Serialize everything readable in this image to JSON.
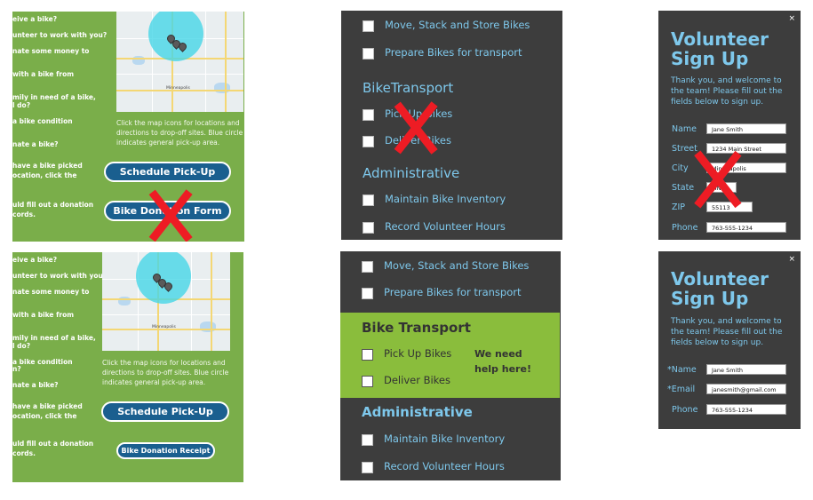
{
  "top_left": {
    "faq": [
      "eive a bike?",
      "unteer to work with you?",
      "nate some money to",
      "with a bike from",
      "mily in need of a bike,",
      "l do?",
      "a bike condition",
      "nate a bike?",
      "have a bike picked",
      "ocation, click the",
      "uld fill out a donation",
      "cords."
    ],
    "map_header": "Minneapolis",
    "map_city": "Minneapolis",
    "note": "Click the map icons for locations and directions to drop-off sites. Blue circle indicates general pick-up area.",
    "schedule_label": "Schedule Pick-Up",
    "donation_label": "Bike Donation Form"
  },
  "bottom_left": {
    "faq": [
      "eive a bike?",
      "unteer to work with you?",
      "nate some money to",
      "with a bike from",
      "mily in need of a bike,",
      "l do?",
      "a bike condition",
      "n?",
      "nate a bike?",
      "have a bike picked",
      "ocation, click the",
      "uld fill out a donation",
      "cords."
    ],
    "map_city": "Minneapolis",
    "note": "Click the map icons for locations and directions to drop-off sites. Blue circle indicates general pick-up area.",
    "schedule_label": "Schedule Pick-Up",
    "donation_label": "Bike Donation Receipt"
  },
  "top_middle": {
    "items_top": [
      "Move, Stack and Store Bikes",
      "Prepare Bikes for transport"
    ],
    "section1": "BikeTransport",
    "items_mid": [
      "Pick Up Bikes",
      "Deliver Bikes"
    ],
    "section2": "Administrative",
    "items_bottom": [
      "Maintain Bike Inventory",
      "Record Volunteer Hours"
    ]
  },
  "bottom_middle": {
    "items_top": [
      "Move, Stack and Store Bikes",
      "Prepare Bikes for transport"
    ],
    "section1": "Bike Transport",
    "items_mid": [
      "Pick Up Bikes",
      "Deliver Bikes"
    ],
    "need_help": [
      "We need",
      "help here!"
    ],
    "section2": "Administrative",
    "items_bottom": [
      "Maintain Bike Inventory",
      "Record Volunteer Hours"
    ]
  },
  "top_right": {
    "close": "×",
    "title": [
      "Volunteer",
      "Sign Up"
    ],
    "intro": "Thank you, and welcome to the team! Please fill out the fields below to sign up.",
    "fields": [
      {
        "label": "Name",
        "value": "Jane Smith"
      },
      {
        "label": "Street",
        "value": "1234 Main Street"
      },
      {
        "label": "City",
        "value": "Minneapolis"
      },
      {
        "label": "State",
        "value": "MN"
      },
      {
        "label": "ZIP",
        "value": "55113"
      },
      {
        "label": "Phone",
        "value": "763-555-1234"
      }
    ]
  },
  "bottom_right": {
    "close": "×",
    "title": [
      "Volunteer",
      "Sign Up"
    ],
    "intro": "Thank you, and welcome to the team! Please fill out the fields below to sign up.",
    "fields": [
      {
        "label": "*Name",
        "value": "Jane Smith"
      },
      {
        "label": "*Email",
        "value": "janesmith@gmail.com"
      },
      {
        "label": "Phone",
        "value": "763-555-1234"
      }
    ]
  },
  "colors": {
    "green": "#7aae4a",
    "dark": "#3d3d3d",
    "accent": "#7ec8ec",
    "button": "#1a5f8f",
    "highlight": "#8abd3c",
    "reject": "#ee1c24"
  },
  "icons": [
    "map-pin-icon",
    "close-icon",
    "reject-x-icon",
    "checkbox-icon"
  ]
}
